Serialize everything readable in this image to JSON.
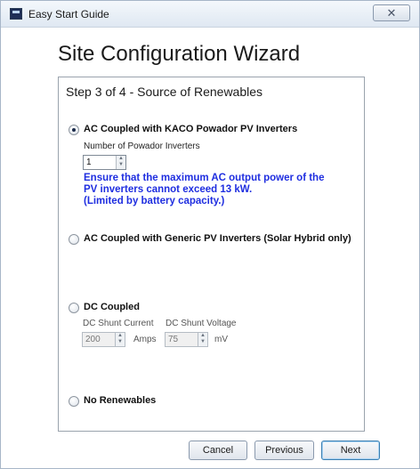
{
  "window": {
    "title": "Easy Start Guide",
    "close_glyph": "✕"
  },
  "heading": "Site Configuration Wizard",
  "step": "Step 3 of 4 - Source of Renewables",
  "options": {
    "kaco": {
      "label": "AC Coupled with KACO Powador PV Inverters",
      "checked": true,
      "inverters_label": "Number of Powador Inverters",
      "inverters_value": "1",
      "warning_lines": [
        "Ensure that the maximum AC output power of the",
        "PV inverters cannot exceed 13 kW.",
        "(Limited by battery capacity.)"
      ]
    },
    "generic": {
      "label": "AC Coupled with Generic PV Inverters (Solar Hybrid only)",
      "checked": false
    },
    "dc": {
      "label": "DC Coupled",
      "checked": false,
      "current_label": "DC Shunt Current",
      "voltage_label": "DC Shunt Voltage",
      "current_value": "200",
      "current_unit": "Amps",
      "voltage_value": "75",
      "voltage_unit": "mV"
    },
    "none": {
      "label": "No Renewables",
      "checked": false
    }
  },
  "buttons": {
    "cancel": "Cancel",
    "previous": "Previous",
    "next": "Next"
  },
  "colors": {
    "warning_text": "#1f2ee0",
    "title_bar": "#dfe8f2"
  }
}
